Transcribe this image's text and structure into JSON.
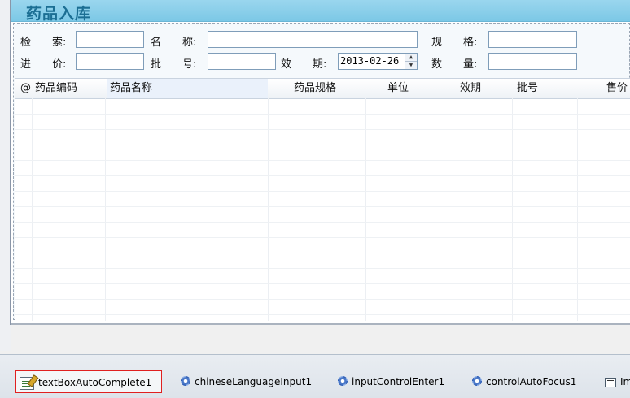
{
  "form": {
    "title": "药品入库",
    "filters": {
      "search_label": "检　　索:",
      "name_label": "名　　称:",
      "spec_label": "规　　格:",
      "price_label": "进　　价:",
      "batch_label": "批　　号:",
      "expiry_label": "效　　期:",
      "expiry_value": "2013-02-26",
      "quantity_label": "数　　量:"
    },
    "grid": {
      "row_marker": "@",
      "columns": [
        "药品编码",
        "药品名称",
        "药品规格",
        "单位",
        "效期",
        "批号",
        "售价"
      ]
    }
  },
  "component_tray": {
    "items": [
      {
        "label": "textBoxAutoComplete1",
        "icon": "textbox-icon",
        "selected": true
      },
      {
        "label": "chineseLanguageInput1",
        "icon": "component-gear-icon",
        "selected": false
      },
      {
        "label": "inputControlEnter1",
        "icon": "component-gear-icon",
        "selected": false
      },
      {
        "label": "controlAutoFocus1",
        "icon": "component-gear-icon",
        "selected": false
      },
      {
        "label": "Im",
        "icon": "image-list-icon",
        "selected": false
      }
    ]
  },
  "colors": {
    "title_bar": "#86cde9",
    "title_text": "#1b6e93",
    "selection_border": "#e02020"
  }
}
